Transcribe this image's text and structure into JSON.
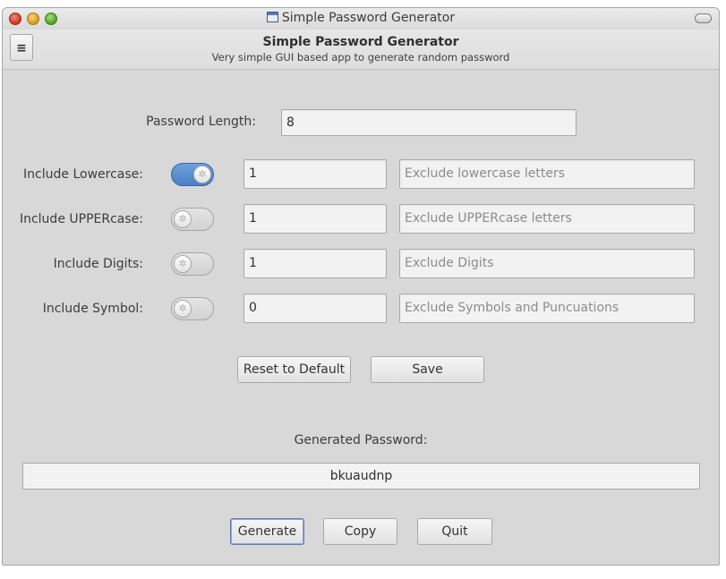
{
  "window": {
    "title": "Simple Password Generator"
  },
  "header": {
    "menu_glyph": "≡",
    "title": "Simple Password Generator",
    "subtitle": "Very simple GUI based app to generate random password"
  },
  "length": {
    "label": "Password Length:",
    "value": "8"
  },
  "options": [
    {
      "label": "Include Lowercase:",
      "enabled": true,
      "count": "1",
      "exclude_placeholder": "Exclude lowercase letters"
    },
    {
      "label": "Include UPPERcase:",
      "enabled": false,
      "count": "1",
      "exclude_placeholder": "Exclude UPPERcase letters"
    },
    {
      "label": "Include Digits:",
      "enabled": false,
      "count": "1",
      "exclude_placeholder": "Exclude Digits"
    },
    {
      "label": "Include Symbol:",
      "enabled": false,
      "count": "0",
      "exclude_placeholder": "Exclude Symbols and Puncuations"
    }
  ],
  "actions": {
    "reset_label": "Reset to Default",
    "save_label": "Save"
  },
  "output": {
    "label": "Generated Password:",
    "value": "bkuaudnp"
  },
  "footer": {
    "generate_label": "Generate",
    "copy_label": "Copy",
    "quit_label": "Quit"
  },
  "colors": {
    "switch_on": "#4d7fc5",
    "window_bg": "#d8d8d8"
  }
}
